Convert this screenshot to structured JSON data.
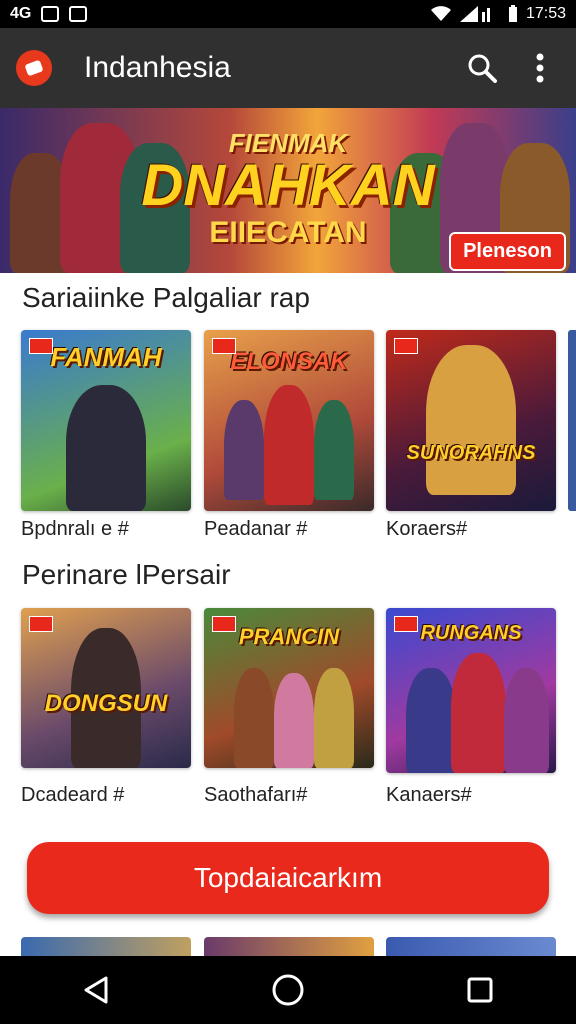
{
  "status_bar": {
    "left_text": "4G",
    "time": "17:53"
  },
  "app_bar": {
    "title": "Indanhesia",
    "logo_icon": "app-logo-icon",
    "actions": [
      "search-icon",
      "more-vert-icon"
    ]
  },
  "banner": {
    "line1": "FIENMAK",
    "line2": "DNAHKAN",
    "line3": "EIIECATAN",
    "button": "Pleneson"
  },
  "sections": [
    {
      "title": "Sariaiinke Palgaliar rap",
      "cards": [
        {
          "art_title": "FANMAH",
          "label": "Bpdnralı e #"
        },
        {
          "art_title": "ELONSAK",
          "label": "Peadanar #"
        },
        {
          "art_title": "SUNORAHNS",
          "label": "Koraers#"
        }
      ]
    },
    {
      "title": "Perinare lPersair",
      "cards": [
        {
          "art_title": "DONGSUN",
          "label": "Dcadeard #"
        },
        {
          "art_title": "PRANCIN",
          "label": "Saothafarı#"
        },
        {
          "art_title": "RUNGANS",
          "label": "Kanaers#"
        }
      ]
    }
  ],
  "cta": {
    "label": "Topdaiaicarkım"
  },
  "colors": {
    "accent": "#e8291c",
    "appbar": "#303030",
    "statusbar": "#000000"
  }
}
